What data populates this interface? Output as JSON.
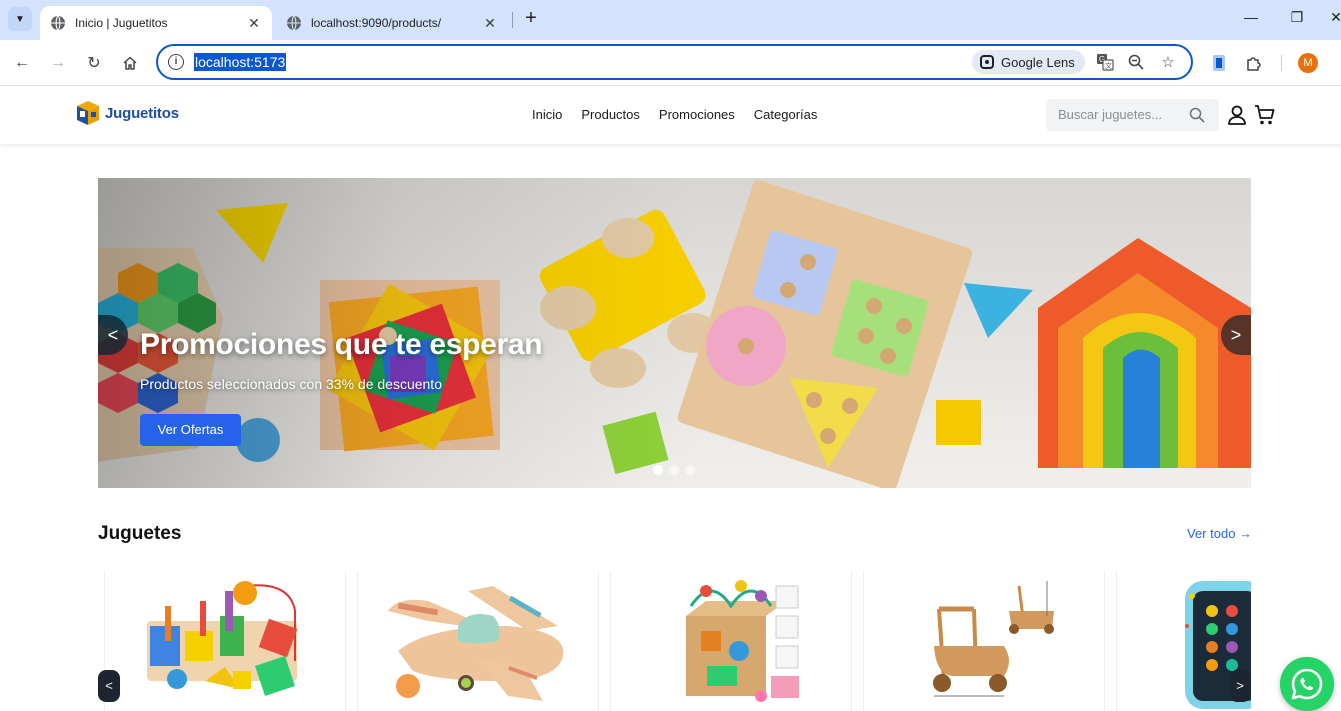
{
  "browser": {
    "tabs": [
      {
        "title": "Inicio | Juguetitos",
        "active": true
      },
      {
        "title": "localhost:9090/products/",
        "active": false
      }
    ],
    "url": "localhost:5173",
    "lens_label": "Google Lens",
    "profile_initial": "M"
  },
  "header": {
    "logo_text": "Juguetitos",
    "nav": [
      "Inicio",
      "Productos",
      "Promociones",
      "Categorías"
    ],
    "search_placeholder": "Buscar juguetes..."
  },
  "hero": {
    "title": "Promociones que te esperan",
    "subtitle": "Productos seleccionados con 33% de descuento",
    "button_label": "Ver Ofertas",
    "prev_label": "<",
    "next_label": ">",
    "slides_total": 3,
    "active_slide": 1
  },
  "products_section": {
    "title": "Juguetes",
    "see_all": "Ver todo →",
    "prev_label": "<",
    "next_label": ">",
    "items": [
      {
        "image": "wooden-shape-sorter-toy"
      },
      {
        "image": "wooden-airplane-toy"
      },
      {
        "image": "activity-cube-toy"
      },
      {
        "image": "wooden-baby-walker-toy"
      },
      {
        "image": "toy-phone"
      }
    ]
  },
  "colors": {
    "accent": "#2563eb",
    "chrome_tabbar": "#d3e3fd",
    "omnibox_border": "#0b57d0",
    "whatsapp": "#25d366"
  }
}
